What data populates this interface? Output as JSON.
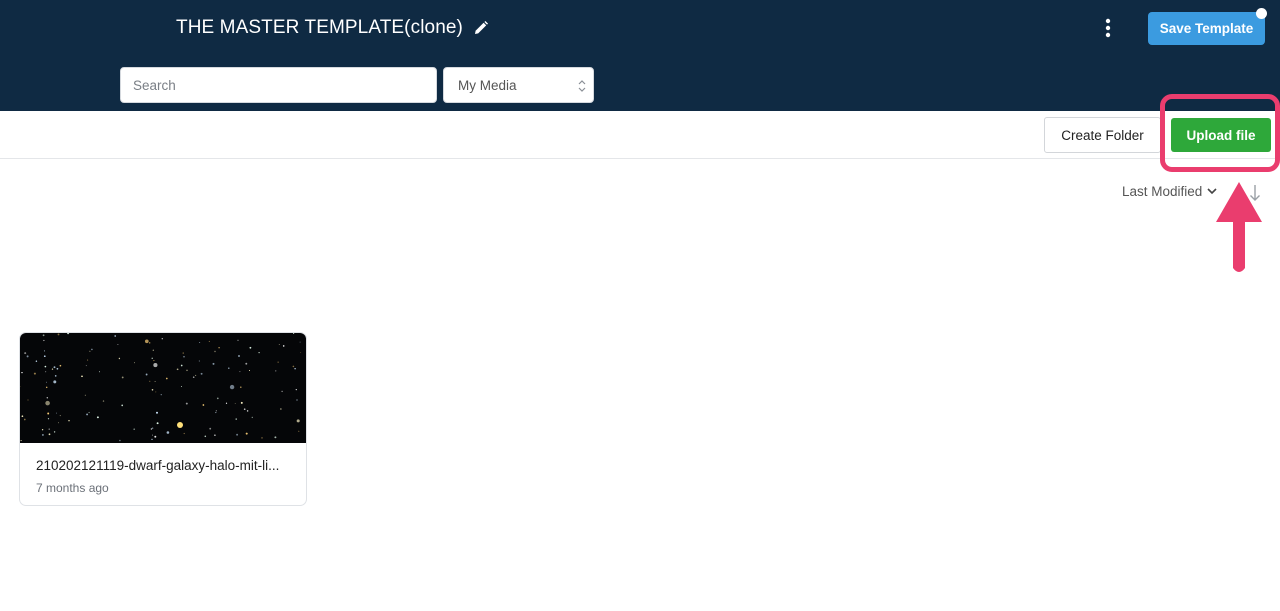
{
  "header": {
    "title": "THE MASTER TEMPLATE(clone)",
    "edit_icon": "pencil-icon",
    "menu_icon": "kebab-menu-icon",
    "save_label": "Save Template"
  },
  "filters": {
    "search_placeholder": "Search",
    "search_value": "",
    "media_selected": "My Media"
  },
  "toolbar": {
    "create_folder_label": "Create Folder",
    "upload_label": "Upload file"
  },
  "sort": {
    "label": "Last Modified",
    "direction_icon": "arrow-down-icon"
  },
  "files": [
    {
      "name": "210202121119-dwarf-galaxy-halo-mit-li...",
      "modified": "7 months ago",
      "thumbnail": "starfield-image"
    }
  ],
  "colors": {
    "header_bg": "#0f2a43",
    "save_button": "#3b9be0",
    "upload_button": "#2ea83a",
    "highlight": "#ea3d6e"
  }
}
